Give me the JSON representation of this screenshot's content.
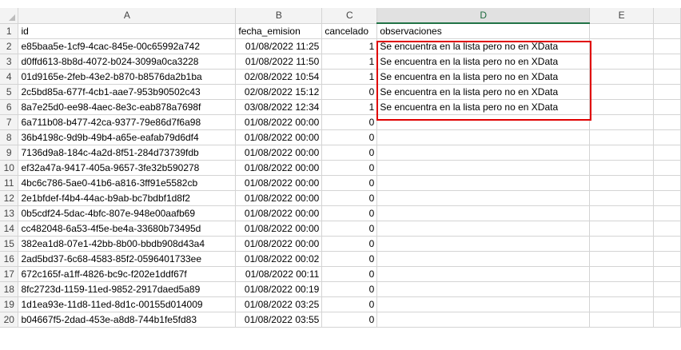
{
  "columns": [
    "",
    "A",
    "B",
    "C",
    "D",
    "E"
  ],
  "selected_column": "D",
  "highlight_color": "#e00000",
  "rows": [
    {
      "n": "1",
      "a": "id",
      "b": "fecha_emision",
      "c": "cancelado",
      "d": "observaciones"
    },
    {
      "n": "2",
      "a": "e85baa5e-1cf9-4cac-845e-00c65992a742",
      "b": "01/08/2022 11:25",
      "c": "1",
      "d": "Se encuentra en la lista pero no en XData"
    },
    {
      "n": "3",
      "a": "d0ffd613-8b8d-4072-b024-3099a0ca3228",
      "b": "01/08/2022 11:50",
      "c": "1",
      "d": "Se encuentra en la lista pero no en XData"
    },
    {
      "n": "4",
      "a": "01d9165e-2feb-43e2-b870-b8576da2b1ba",
      "b": "02/08/2022 10:54",
      "c": "1",
      "d": "Se encuentra en la lista pero no en XData"
    },
    {
      "n": "5",
      "a": "2c5bd85a-677f-4cb1-aae7-953b90502c43",
      "b": "02/08/2022 15:12",
      "c": "0",
      "d": "Se encuentra en la lista pero no en XData"
    },
    {
      "n": "6",
      "a": "8a7e25d0-ee98-4aec-8e3c-eab878a7698f",
      "b": "03/08/2022 12:34",
      "c": "1",
      "d": "Se encuentra en la lista pero no en XData"
    },
    {
      "n": "7",
      "a": "6a711b08-b477-42ca-9377-79e86d7f6a98",
      "b": "01/08/2022 00:00",
      "c": "0",
      "d": ""
    },
    {
      "n": "8",
      "a": "36b4198c-9d9b-49b4-a65e-eafab79d6df4",
      "b": "01/08/2022 00:00",
      "c": "0",
      "d": ""
    },
    {
      "n": "9",
      "a": "7136d9a8-184c-4a2d-8f51-284d73739fdb",
      "b": "01/08/2022 00:00",
      "c": "0",
      "d": ""
    },
    {
      "n": "10",
      "a": "ef32a47a-9417-405a-9657-3fe32b590278",
      "b": "01/08/2022 00:00",
      "c": "0",
      "d": ""
    },
    {
      "n": "11",
      "a": "4bc6c786-5ae0-41b6-a816-3ff91e5582cb",
      "b": "01/08/2022 00:00",
      "c": "0",
      "d": ""
    },
    {
      "n": "12",
      "a": "2e1bfdef-f4b4-44ac-b9ab-bc7bdbf1d8f2",
      "b": "01/08/2022 00:00",
      "c": "0",
      "d": ""
    },
    {
      "n": "13",
      "a": "0b5cdf24-5dac-4bfc-807e-948e00aafb69",
      "b": "01/08/2022 00:00",
      "c": "0",
      "d": ""
    },
    {
      "n": "14",
      "a": "cc482048-6a53-4f5e-be4a-33680b73495d",
      "b": "01/08/2022 00:00",
      "c": "0",
      "d": ""
    },
    {
      "n": "15",
      "a": "382ea1d8-07e1-42bb-8b00-bbdb908d43a4",
      "b": "01/08/2022 00:00",
      "c": "0",
      "d": ""
    },
    {
      "n": "16",
      "a": "2ad5bd37-6c68-4583-85f2-0596401733ee",
      "b": "01/08/2022 00:02",
      "c": "0",
      "d": ""
    },
    {
      "n": "17",
      "a": "672c165f-a1ff-4826-bc9c-f202e1ddf67f",
      "b": "01/08/2022 00:11",
      "c": "0",
      "d": ""
    },
    {
      "n": "18",
      "a": "8fc2723d-1159-11ed-9852-2917daed5a89",
      "b": "01/08/2022 00:19",
      "c": "0",
      "d": ""
    },
    {
      "n": "19",
      "a": "1d1ea93e-11d8-11ed-8d1c-00155d014009",
      "b": "01/08/2022 03:25",
      "c": "0",
      "d": ""
    },
    {
      "n": "20",
      "a": "b04667f5-2dad-453e-a8d8-744b1fe5fd83",
      "b": "01/08/2022 03:55",
      "c": "0",
      "d": ""
    }
  ]
}
